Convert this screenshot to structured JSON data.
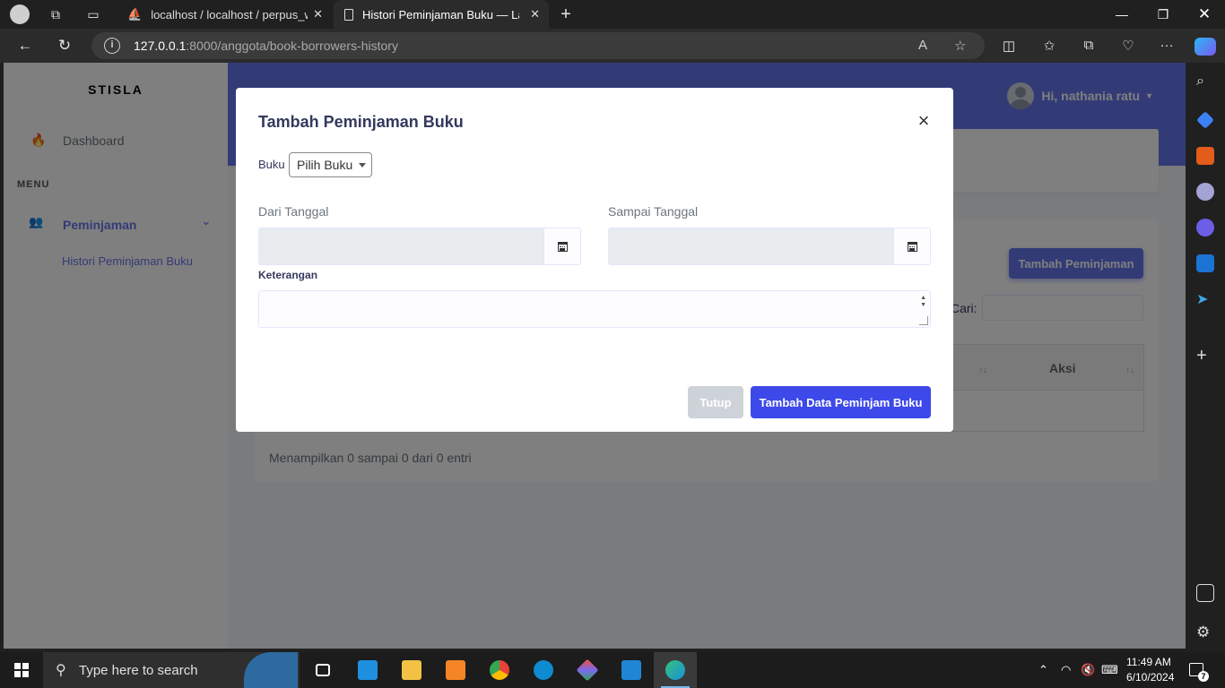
{
  "browser": {
    "tabs": [
      {
        "title": "localhost / localhost / perpus_we",
        "active": false,
        "icon": "phpmyadmin-icon"
      },
      {
        "title": "Histori Peminjaman Buku — Lara",
        "active": true,
        "icon": "page-icon"
      }
    ],
    "url_host": "127.0.0.1",
    "url_rest": ":8000/anggota/book-borrowers-history"
  },
  "app": {
    "brand": "STISLA",
    "sidebar": {
      "dashboard_label": "Dashboard",
      "menu_header": "MENU",
      "peminjaman_label": "Peminjaman",
      "history_label": "Histori Peminjaman Buku"
    },
    "navbar": {
      "user_greeting": "Hi, nathania ratu"
    },
    "page": {
      "add_button": "Tambah Peminjaman",
      "search_label": "Cari:",
      "col_aksi": "Aksi",
      "info": "Menampilkan 0 sampai 0 dari 0 entri"
    }
  },
  "modal": {
    "title": "Tambah Peminjaman Buku",
    "close_symbol": "×",
    "book_label": "Buku",
    "book_select": "Pilih Buku",
    "from_label": "Dari Tanggal",
    "to_label": "Sampai Tanggal",
    "desc_label": "Keterangan",
    "btn_close": "Tutup",
    "btn_submit": "Tambah Data Peminjam Buku"
  },
  "colors": {
    "primary": "#6777ef",
    "submit": "#3d49e8",
    "close_btn": "#cdd3d8"
  },
  "taskbar": {
    "search_placeholder": "Type here to search",
    "time": "11:49 AM",
    "date": "6/10/2024",
    "notification_count": "7"
  }
}
